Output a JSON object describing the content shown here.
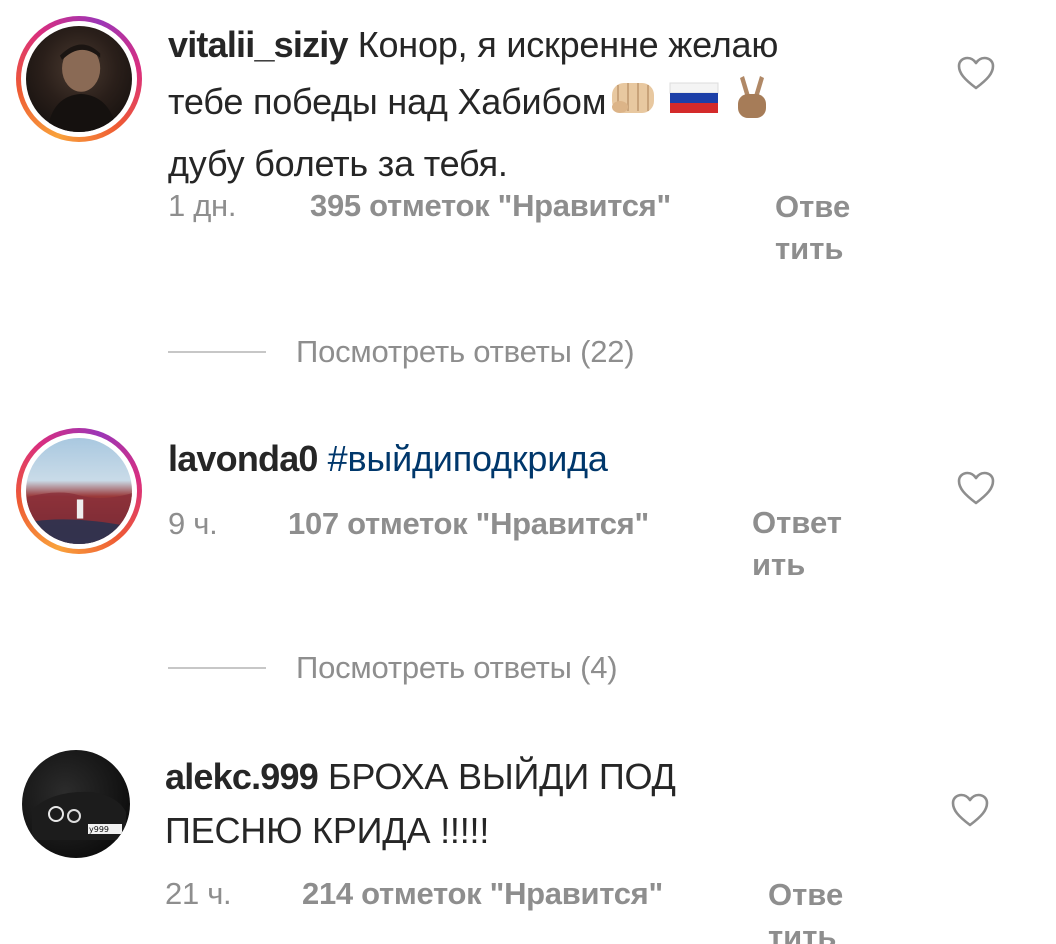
{
  "comments": [
    {
      "username": "vitalii_siziy",
      "text_line1": "Конор, я искренне желаю",
      "text_line2": "тебе победы над Хабибом",
      "text_line3": "дубу болеть за тебя.",
      "emojis": [
        "fist-emoji",
        "russia-flag-emoji",
        "victory-hand-emoji"
      ],
      "time": "1 дн.",
      "likes": "395 отметок \"Нравится\"",
      "reply_label": "Ответить",
      "reply_line1": "Отве",
      "reply_line2": "тить",
      "view_replies": "Посмотреть ответы (22)"
    },
    {
      "username": "lavonda0",
      "hashtag": "#выйдиподкрида",
      "time": "9 ч.",
      "likes": "107 отметок \"Нравится\"",
      "reply_line1": "Ответ",
      "reply_line2": "ить",
      "view_replies": "Посмотреть ответы (4)"
    },
    {
      "username": "alekc.999",
      "text_line1": "БРОХА ВЫЙДИ ПОД",
      "text_line2": "ПЕСНЮ КРИДА !!!!!",
      "time": "21 ч.",
      "likes": "214 отметок \"Нравится\"",
      "reply_line1": "Отве",
      "reply_line2": "тить",
      "avatar_plate": "у999"
    }
  ],
  "colors": {
    "text": "#262626",
    "meta": "#8e8e8e",
    "hashtag": "#00376b",
    "divider": "#c7c7c7"
  }
}
